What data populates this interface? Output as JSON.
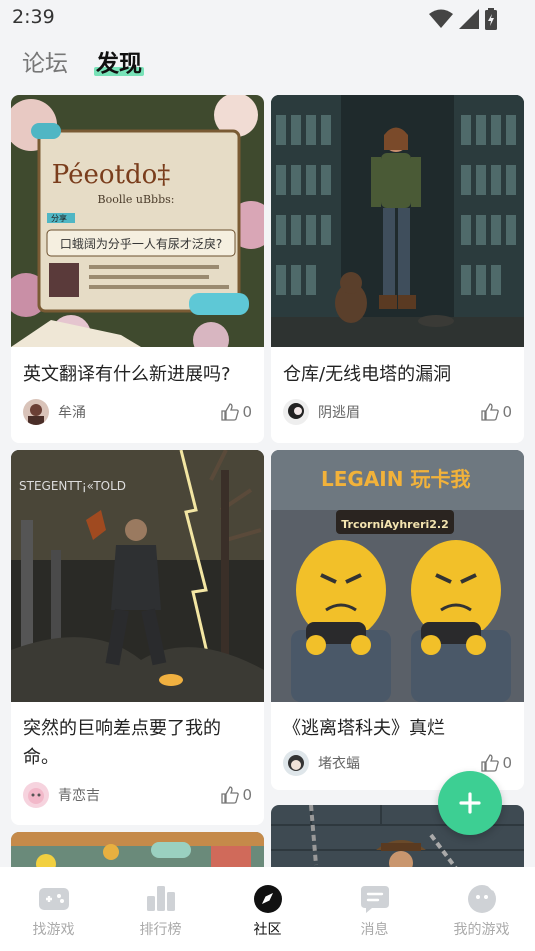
{
  "status_bar": {
    "time": "2:39"
  },
  "top_tabs": [
    {
      "label": "论坛"
    },
    {
      "label": "发现"
    }
  ],
  "posts": [
    {
      "title": "英文翻译有什么新进展吗?",
      "author": "牟涌",
      "likes": "0",
      "image_text": {
        "line1": "Péeotdo‡",
        "line2": "Boolle uBbbs:",
        "line3": "口蛾阔为分乎一人有尿才泛戾?",
        "tag": "分享"
      }
    },
    {
      "title": "仓库/无线电塔的漏洞",
      "author": "阴逃眉",
      "likes": "0"
    },
    {
      "title": "突然的巨响差点要了我的命。",
      "author": "青恋吉",
      "likes": "0",
      "image_text": {
        "line1": "STEGENTT¡«TOLD"
      }
    },
    {
      "title": "《逃离塔科夫》真烂",
      "author": "堵衣蝠",
      "likes": "0",
      "image_text": {
        "line1": "LEGAIN 玩卡我",
        "line2": "TrcorniAyhreri2.2"
      }
    }
  ],
  "fab": {
    "label": "+"
  },
  "bottom_nav": [
    {
      "label": "找游戏",
      "icon": "gamepad-icon"
    },
    {
      "label": "排行榜",
      "icon": "ranking-icon"
    },
    {
      "label": "社区",
      "icon": "compass-icon"
    },
    {
      "label": "消息",
      "icon": "message-icon"
    },
    {
      "label": "我的游戏",
      "icon": "profile-icon"
    }
  ],
  "colors": {
    "accent": "#3dcf93",
    "tab_highlight": "#78e2b8"
  }
}
